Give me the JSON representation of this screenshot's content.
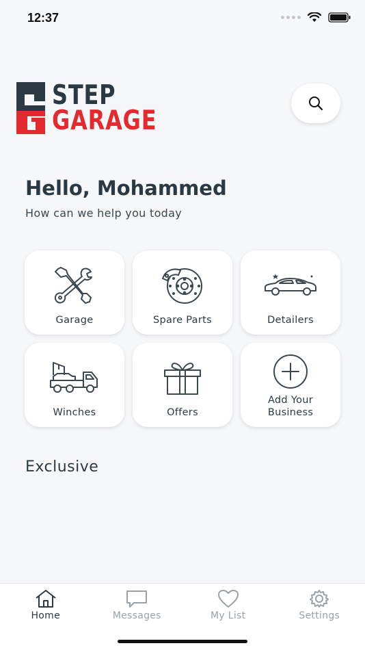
{
  "status_bar": {
    "time": "12:37"
  },
  "logo": {
    "line1": "STEP",
    "line2": "GARAGE",
    "brand_dark": "#2b3a42",
    "brand_red": "#e42a2f"
  },
  "search": {
    "icon": "search-icon"
  },
  "greeting": {
    "title": "Hello, Mohammed",
    "subtitle": "How can we help you today"
  },
  "services": [
    {
      "label": "Garage",
      "icon": "wrench-cross-icon"
    },
    {
      "label": "Spare Parts",
      "icon": "brake-disc-icon"
    },
    {
      "label": "Detailers",
      "icon": "car-sparkle-icon"
    },
    {
      "label": "Winches",
      "icon": "tow-truck-icon"
    },
    {
      "label": "Offers",
      "icon": "gift-icon"
    },
    {
      "label": "Add Your Business",
      "icon": "plus-circle-icon"
    }
  ],
  "sections": {
    "exclusive": "Exclusive"
  },
  "tabs": [
    {
      "label": "Home",
      "icon": "home-icon",
      "active": true
    },
    {
      "label": "Messages",
      "icon": "chat-icon",
      "active": false
    },
    {
      "label": "My List",
      "icon": "heart-icon",
      "active": false
    },
    {
      "label": "Settings",
      "icon": "gear-icon",
      "active": false
    }
  ]
}
